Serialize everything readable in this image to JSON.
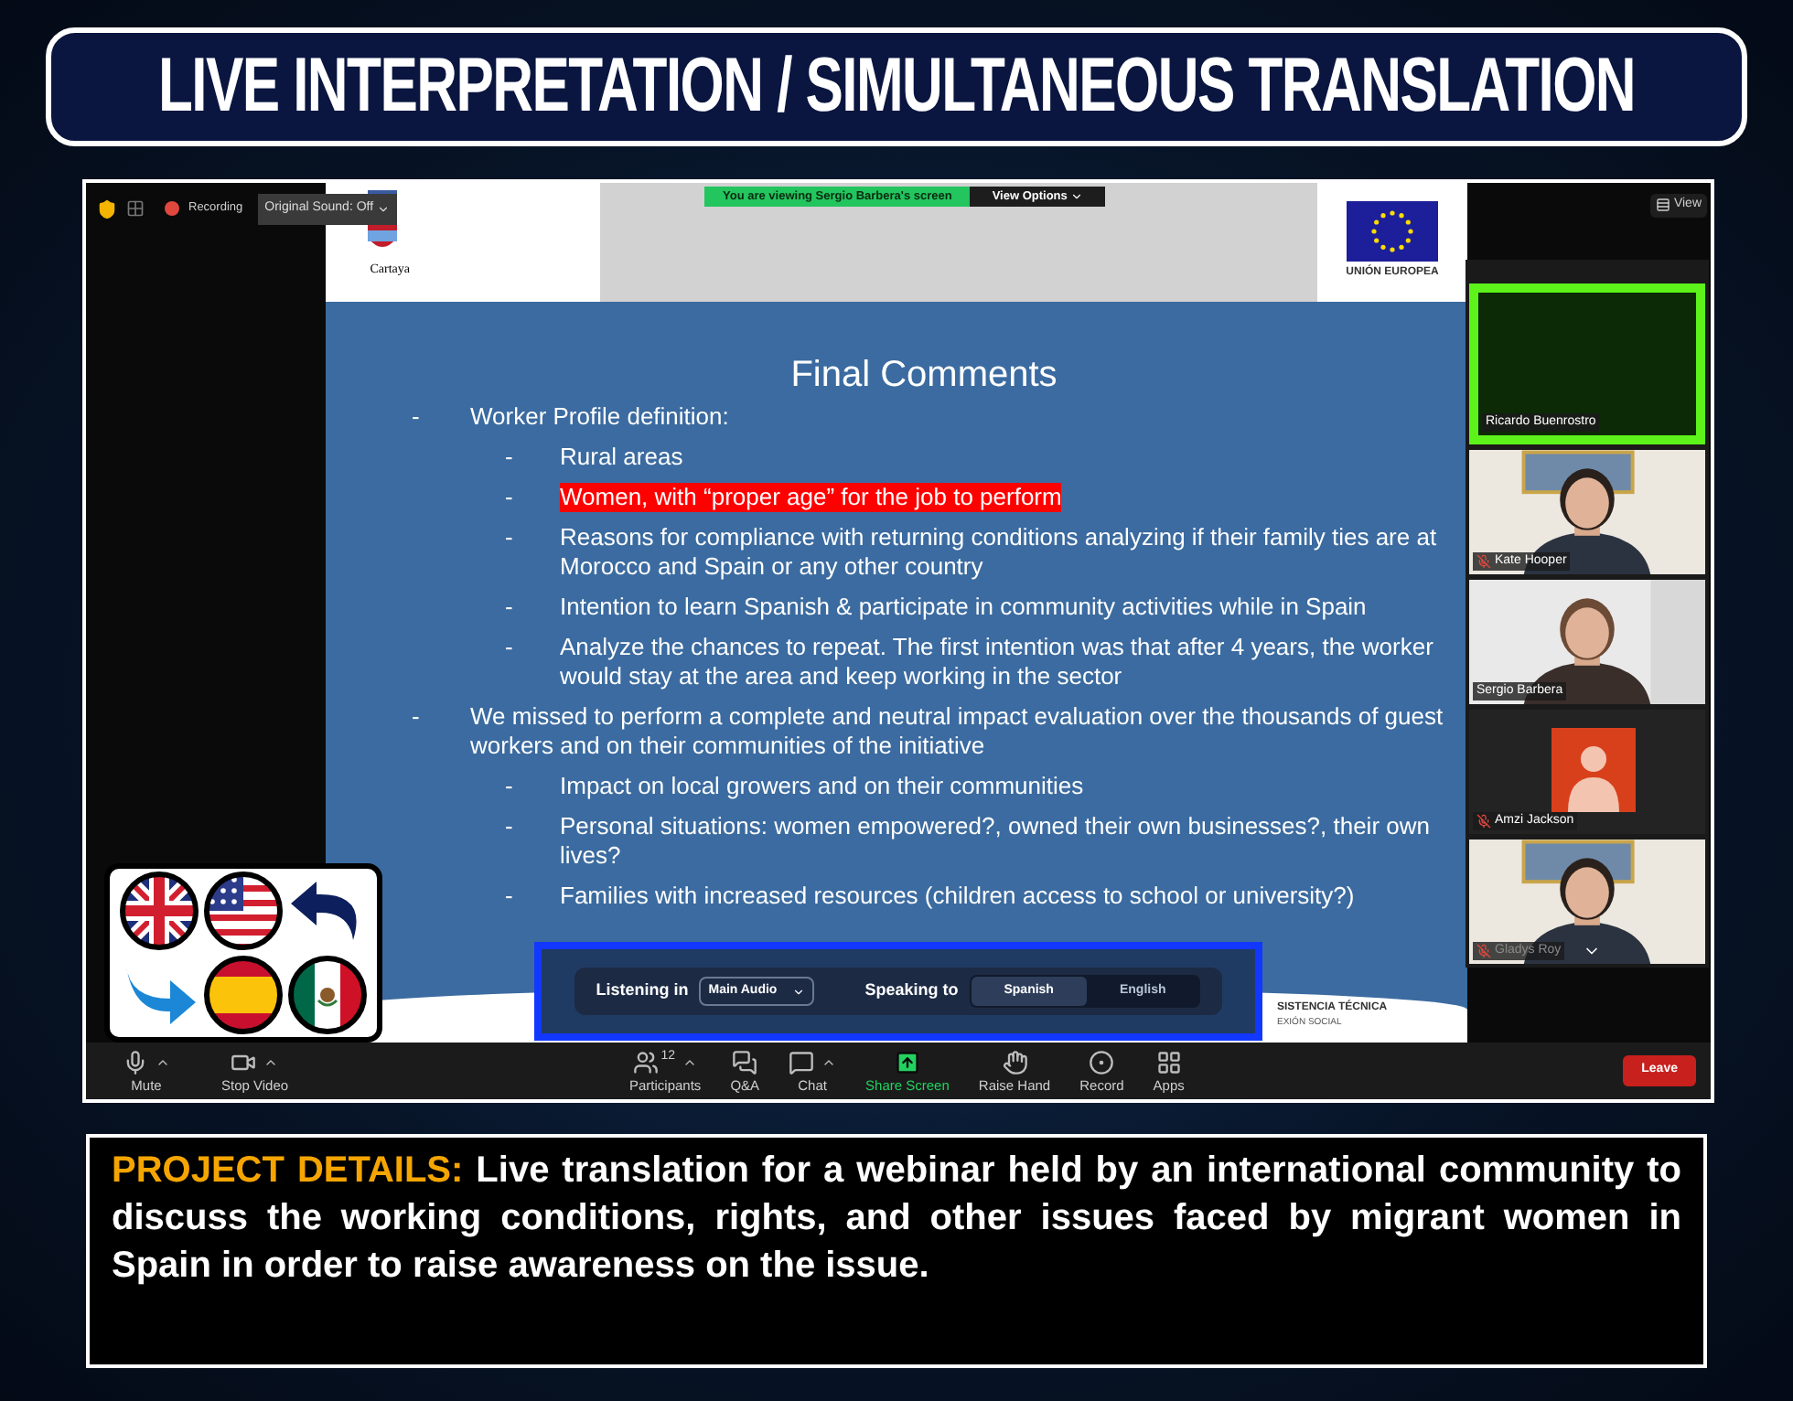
{
  "banner": {
    "title": "LIVE INTERPRETATION / SIMULTANEOUS TRANSLATION"
  },
  "meeting": {
    "top_bar": {
      "recording": "Recording",
      "audio_menu": "Original Sound: Off"
    },
    "share_banner": "You are viewing Sergio Barbera's screen",
    "view_options": "View Options",
    "view": "View",
    "slide": {
      "left_logo_caption": "Cartaya",
      "right_logo_caption": "UNIÓN EUROPEA",
      "title": "Final Comments",
      "bullets": [
        {
          "marker": "-",
          "text": "Worker Profile definition:",
          "children": [
            {
              "marker": "-",
              "text": "Rural areas",
              "highlighted": false
            },
            {
              "marker": "-",
              "text": "Women, with “proper age” for the job to perform",
              "highlighted": true
            },
            {
              "marker": "-",
              "text": "Reasons for compliance with returning conditions analyzing if their family ties are at Morocco and Spain or any other country",
              "highlighted": false
            },
            {
              "marker": "-",
              "text": "Intention to learn Spanish & participate in community activities while in Spain",
              "highlighted": false
            },
            {
              "marker": "-",
              "text": "Analyze the chances to repeat. The first intention was that after 4 years, the worker would stay at the area and keep working in the sector",
              "highlighted": false
            }
          ]
        },
        {
          "marker": "-",
          "text": "We missed to perform a complete and neutral impact evaluation over the thousands of guest workers and on their communities of the initiative",
          "children": [
            {
              "marker": "-",
              "text": "Impact on local growers and on their communities",
              "highlighted": false
            },
            {
              "marker": "-",
              "text": "Personal situations: women empowered?, owned their own businesses?, their own lives?",
              "highlighted": false
            },
            {
              "marker": "-",
              "text": "Families with increased resources (children access to school or university?)",
              "highlighted": false
            }
          ]
        }
      ],
      "footer_texts": [
        "SISTENCIA TÉCNICA",
        "EXIÓN SOCIAL"
      ]
    },
    "interpretation": {
      "listening_label": "Listening in",
      "listening_value": "Main Audio",
      "speaking_label": "Speaking to",
      "languages": [
        {
          "label": "Spanish",
          "selected": true
        },
        {
          "label": "English",
          "selected": false
        }
      ]
    },
    "participants": [
      {
        "name": "Ricardo Buenrostro",
        "kind": "empty",
        "muted": false,
        "highlighted": true
      },
      {
        "name": "Kate Hooper",
        "kind": "video",
        "muted": true,
        "highlighted": false
      },
      {
        "name": "Sergio Barbera",
        "kind": "video",
        "muted": false,
        "highlighted": false
      },
      {
        "name": "Amzi Jackson",
        "kind": "avatar",
        "muted": true,
        "highlighted": false
      },
      {
        "name": "Gladys Roy",
        "kind": "video",
        "muted": true,
        "highlighted": false
      }
    ],
    "toolbar": {
      "left": [
        {
          "kind": "mic",
          "label": "Mute"
        },
        {
          "kind": "video",
          "label": "Stop Video"
        }
      ],
      "center": [
        {
          "kind": "participants",
          "label": "Participants",
          "count": "12"
        },
        {
          "kind": "qa",
          "label": "Q&A"
        },
        {
          "kind": "chat",
          "label": "Chat"
        },
        {
          "kind": "share",
          "label": "Share Screen"
        },
        {
          "kind": "hand",
          "label": "Raise Hand"
        },
        {
          "kind": "record",
          "label": "Record"
        },
        {
          "kind": "apps",
          "label": "Apps"
        }
      ],
      "leave": "Leave"
    }
  },
  "details": {
    "label": "PROJECT DETAILS:",
    "text": "Live translation for a webinar held by an international community to discuss the working conditions, rights, and other issues faced by migrant women in Spain in order to raise awareness on the issue."
  }
}
